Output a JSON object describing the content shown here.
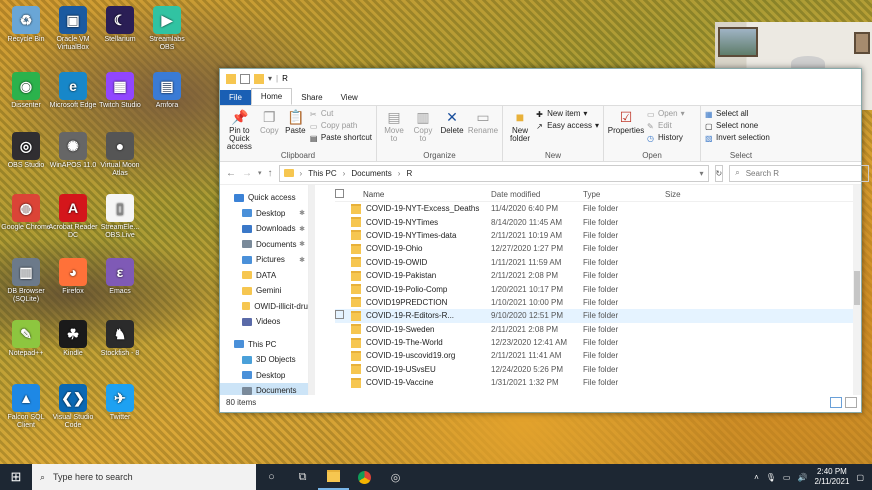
{
  "desktop": {
    "icons": [
      {
        "label": "Recycle Bin",
        "icon": "recycle-bin-icon",
        "color": "#6aa6d6",
        "glyph": "♻"
      },
      {
        "label": "Oracle VM VirtualBox",
        "icon": "virtualbox-icon",
        "color": "#1b5aa0",
        "glyph": "▣"
      },
      {
        "label": "Stellarium",
        "icon": "stellarium-icon",
        "color": "#2a1e55",
        "glyph": "☾"
      },
      {
        "label": "Streamlabs OBS",
        "icon": "streamlabs-icon",
        "color": "#31c3a2",
        "glyph": "▶"
      },
      {
        "label": "Dissenter",
        "icon": "dissenter-icon",
        "color": "#2bb24c",
        "glyph": "◉"
      },
      {
        "label": "Microsoft Edge",
        "icon": "edge-icon",
        "color": "#1787c9",
        "glyph": "e"
      },
      {
        "label": "Twitch Studio",
        "icon": "twitch-icon",
        "color": "#9146ff",
        "glyph": "▦"
      },
      {
        "label": "Amfora",
        "icon": "amfora-icon",
        "color": "#3a7bd5",
        "glyph": "▤"
      },
      {
        "label": "OBS Studio",
        "icon": "obs-icon",
        "color": "#302e31",
        "glyph": "◎"
      },
      {
        "label": "WinAPOS 11.0",
        "icon": "winapos-icon",
        "color": "#666666",
        "glyph": "✺"
      },
      {
        "label": "Virtual Moon Atlas",
        "icon": "moon-atlas-icon",
        "color": "#555555",
        "glyph": "●"
      },
      {
        "label": "Google Chrome",
        "icon": "chrome-icon",
        "color": "#db4437",
        "glyph": "◍"
      },
      {
        "label": "Acrobat Reader DC",
        "icon": "acrobat-icon",
        "color": "#d4161b",
        "glyph": "A"
      },
      {
        "label": "StreamEle... OBS.Live",
        "icon": "document-icon",
        "color": "#f5f5f5",
        "glyph": "▯"
      },
      {
        "label": "DB Browser (SQLite)",
        "icon": "db-browser-icon",
        "color": "#6c7a8a",
        "glyph": "▥"
      },
      {
        "label": "Firefox",
        "icon": "firefox-icon",
        "color": "#ff7139",
        "glyph": "◕"
      },
      {
        "label": "Emacs",
        "icon": "emacs-icon",
        "color": "#7f5ab6",
        "glyph": "ε"
      },
      {
        "label": "Notepad++",
        "icon": "notepadpp-icon",
        "color": "#8dc63f",
        "glyph": "✎"
      },
      {
        "label": "Kindle",
        "icon": "kindle-icon",
        "color": "#1a1a1a",
        "glyph": "☘"
      },
      {
        "label": "Stockfish - 8",
        "icon": "stockfish-icon",
        "color": "#2b2b2b",
        "glyph": "♞"
      },
      {
        "label": "Falcon SQL Client",
        "icon": "falcon-icon",
        "color": "#1e88e5",
        "glyph": "▲"
      },
      {
        "label": "Visual Studio Code",
        "icon": "vscode-icon",
        "color": "#0a68b4",
        "glyph": "❮❯"
      },
      {
        "label": "Twitter",
        "icon": "twitter-icon",
        "color": "#1da1f2",
        "glyph": "✈"
      }
    ]
  },
  "explorer": {
    "title": "R",
    "tabs": [
      "File",
      "Home",
      "Share",
      "View"
    ],
    "ribbon": {
      "clipboard": {
        "label": "Clipboard",
        "pin": "Pin to Quick access",
        "copy": "Copy",
        "paste": "Paste",
        "cut": "Cut",
        "copy_path": "Copy path",
        "paste_shortcut": "Paste shortcut"
      },
      "organize": {
        "label": "Organize",
        "move_to": "Move to",
        "copy_to": "Copy to",
        "delete": "Delete",
        "rename": "Rename"
      },
      "new": {
        "label": "New",
        "new_folder": "New folder",
        "new_item": "New item",
        "easy_access": "Easy access"
      },
      "open": {
        "label": "Open",
        "properties": "Properties",
        "open": "Open",
        "edit": "Edit",
        "history": "History"
      },
      "select": {
        "label": "Select",
        "select_all": "Select all",
        "select_none": "Select none",
        "invert": "Invert selection"
      }
    },
    "address": {
      "crumbs": [
        "This PC",
        "Documents",
        "R"
      ],
      "search_placeholder": "Search R"
    },
    "nav": [
      {
        "label": "Quick access",
        "indent": 0,
        "pin": false,
        "icon": "star-icon",
        "color": "#3b82d6"
      },
      {
        "label": "Desktop",
        "indent": 1,
        "pin": true,
        "icon": "desktop-folder-icon",
        "color": "#4a90d9"
      },
      {
        "label": "Downloads",
        "indent": 1,
        "pin": true,
        "icon": "downloads-folder-icon",
        "color": "#3a78c8"
      },
      {
        "label": "Documents",
        "indent": 1,
        "pin": true,
        "icon": "documents-folder-icon",
        "color": "#7a8a9a"
      },
      {
        "label": "Pictures",
        "indent": 1,
        "pin": true,
        "icon": "pictures-folder-icon",
        "color": "#4a90d9"
      },
      {
        "label": "DATA",
        "indent": 1,
        "pin": false,
        "icon": "folder-icon",
        "color": "#f6c650"
      },
      {
        "label": "Gemini",
        "indent": 1,
        "pin": false,
        "icon": "folder-icon",
        "color": "#f6c650"
      },
      {
        "label": "OWID-illicit-dru",
        "indent": 1,
        "pin": false,
        "icon": "folder-icon",
        "color": "#f6c650"
      },
      {
        "label": "Videos",
        "indent": 1,
        "pin": false,
        "icon": "videos-folder-icon",
        "color": "#5a6aa8"
      },
      {
        "label": "This PC",
        "indent": 0,
        "pin": false,
        "icon": "computer-icon",
        "color": "#4a90d9",
        "gap": true
      },
      {
        "label": "3D Objects",
        "indent": 1,
        "pin": false,
        "icon": "3d-objects-icon",
        "color": "#4aa0d9"
      },
      {
        "label": "Desktop",
        "indent": 1,
        "pin": false,
        "icon": "desktop-folder-icon",
        "color": "#4a90d9"
      },
      {
        "label": "Documents",
        "indent": 1,
        "pin": false,
        "icon": "documents-folder-icon",
        "color": "#7a8a9a",
        "selected": true
      }
    ],
    "columns": {
      "name": "Name",
      "date": "Date modified",
      "type": "Type",
      "size": "Size"
    },
    "rows": [
      {
        "name": "COVID-19-NYT-Excess_Deaths",
        "date": "11/4/2020 6:40 PM",
        "type": "File folder"
      },
      {
        "name": "COVID-19-NYTimes",
        "date": "8/14/2020 11:45 AM",
        "type": "File folder"
      },
      {
        "name": "COVID-19-NYTimes-data",
        "date": "2/11/2021 10:19 AM",
        "type": "File folder"
      },
      {
        "name": "COVID-19-Ohio",
        "date": "12/27/2020 1:27 PM",
        "type": "File folder"
      },
      {
        "name": "COVID-19-OWID",
        "date": "1/11/2021 11:59 AM",
        "type": "File folder"
      },
      {
        "name": "COVID-19-Pakistan",
        "date": "2/11/2021 2:08 PM",
        "type": "File folder"
      },
      {
        "name": "COVID-19-Polio-Comp",
        "date": "1/20/2021 10:17 PM",
        "type": "File folder"
      },
      {
        "name": "COVID19PREDCTION",
        "date": "1/10/2021 10:00 PM",
        "type": "File folder"
      },
      {
        "name": "COVID-19-R-Editors-R...",
        "date": "9/10/2020 12:51 PM",
        "type": "File folder",
        "hover": true
      },
      {
        "name": "COVID-19-Sweden",
        "date": "2/11/2021 2:08 PM",
        "type": "File folder"
      },
      {
        "name": "COVID-19-The-World",
        "date": "12/23/2020 12:41 AM",
        "type": "File folder"
      },
      {
        "name": "COVID-19-uscovid19.org",
        "date": "2/11/2021 11:41 AM",
        "type": "File folder"
      },
      {
        "name": "COVID-19-USvsEU",
        "date": "12/24/2020 5:26 PM",
        "type": "File folder"
      },
      {
        "name": "COVID-19-Vaccine",
        "date": "1/31/2021 1:32 PM",
        "type": "File folder"
      }
    ],
    "status": "80 items"
  },
  "taskbar": {
    "search_placeholder": "Type here to search",
    "time": "2:40 PM",
    "date": "2/11/2021"
  }
}
